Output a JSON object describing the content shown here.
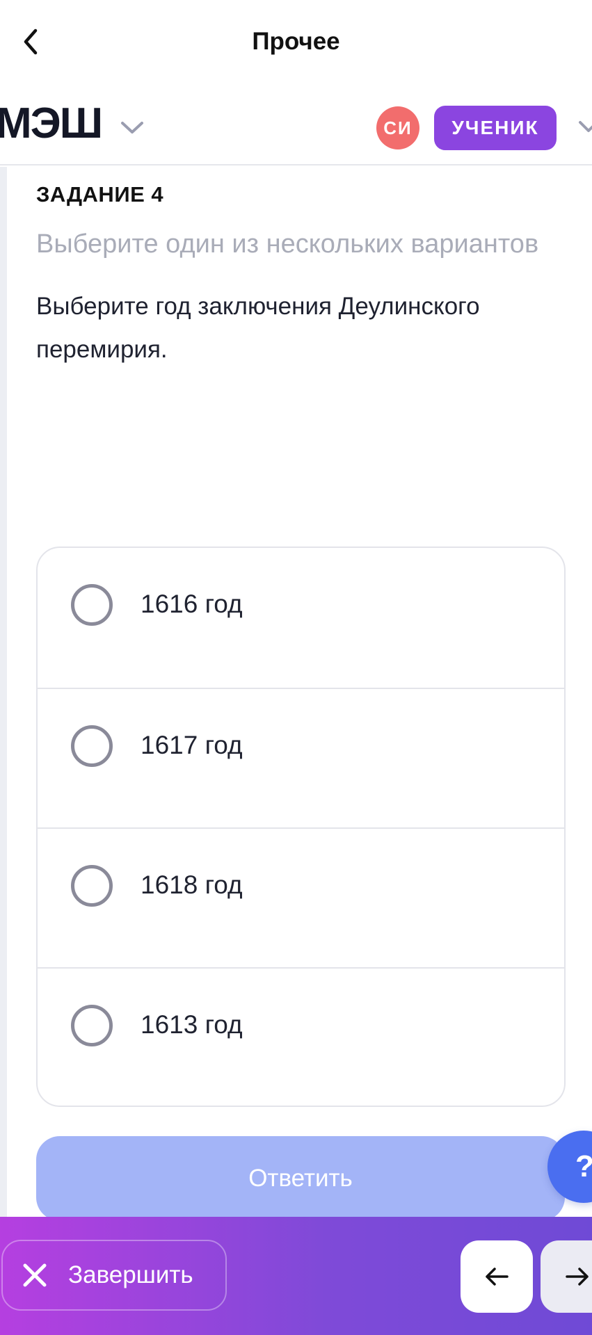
{
  "nav": {
    "title": "Прочее",
    "back_icon": "chevron-left-icon"
  },
  "header": {
    "logo_text": "МЭШ",
    "logo_chevron_icon": "chevron-down-icon",
    "avatar_initials": "СИ",
    "avatar_color": "#f26d6d",
    "role_label": "УЧЕНИК",
    "role_color": "#8b45e0",
    "role_chevron_icon": "chevron-down-icon"
  },
  "task": {
    "label": "ЗАДАНИЕ 4",
    "instruction": "Выберите один из нескольких вариантов",
    "question": "Выберите год заключения Деулинского перемирия."
  },
  "options": [
    {
      "label": "1616 год",
      "selected": false
    },
    {
      "label": "1617 год",
      "selected": false
    },
    {
      "label": "1618 год",
      "selected": false
    },
    {
      "label": "1613 год",
      "selected": false
    }
  ],
  "answer_button": {
    "label": "Ответить",
    "color": "#a3b4f7"
  },
  "help_button": {
    "label": "?",
    "color": "#4a6ef0"
  },
  "bottom_bar": {
    "finish_label": "Завершить",
    "finish_icon": "close-icon",
    "prev_icon": "arrow-left-icon",
    "next_icon": "arrow-right-icon",
    "gradient_start": "#b53fe0",
    "gradient_end": "#6f4ad6"
  }
}
